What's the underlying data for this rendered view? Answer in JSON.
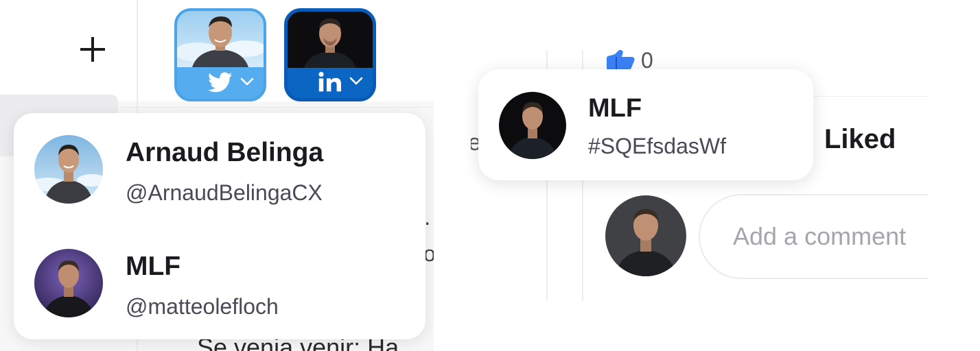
{
  "colors": {
    "twitter_blue": "#55acee",
    "linkedin_blue": "#0a66c2",
    "liked_heart": "#e8306e",
    "thumb_blue": "#3b82f6",
    "placeholder_gray": "#a5a5ad"
  },
  "icons": {
    "add": "plus-icon",
    "twitter": "twitter-bird-icon",
    "linkedin": "linkedin-in-icon",
    "chevron": "chevron-down-icon",
    "like": "thumbs-up-icon",
    "liked": "heart-icon"
  },
  "left": {
    "add_button_glyph": "+",
    "accounts_dropdown": [
      {
        "name": "Arnaud Belinga",
        "handle": "@ArnaudBelingaCX"
      },
      {
        "name": "MLF",
        "handle": "@matteolefloch"
      }
    ],
    "background_text": {
      "dot": ".",
      "o_fragment": "o",
      "bottom_fragment": "Se venia venir: Ha"
    }
  },
  "right": {
    "like_count": "0",
    "partial_text": "e",
    "popover": {
      "name": "MLF",
      "id": "#SQEfsdasWf"
    },
    "liked_label": "Liked",
    "comment_placeholder": "Add a comment"
  }
}
